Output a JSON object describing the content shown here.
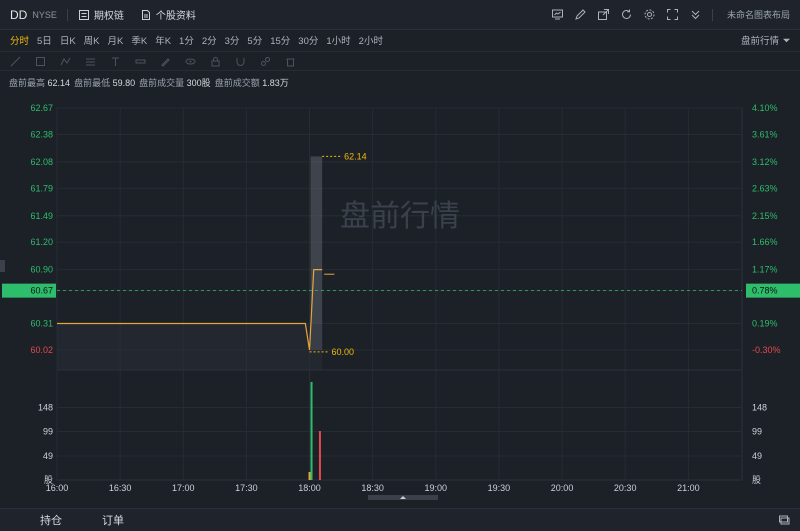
{
  "header": {
    "symbol": "DD",
    "exchange": "NYSE",
    "options_chain_label": "期权链",
    "stock_profile_label": "个股资料",
    "layout_label": "未命名图表布局"
  },
  "periods": [
    "分时",
    "5日",
    "日K",
    "周K",
    "月K",
    "季K",
    "年K",
    "1分",
    "2分",
    "3分",
    "5分",
    "15分",
    "30分",
    "1小时",
    "2小时"
  ],
  "active_period": "分时",
  "session_selector": "盘前行情",
  "stats": [
    {
      "label": "盘前最高",
      "value": "62.14"
    },
    {
      "label": "盘前最低",
      "value": "59.80"
    },
    {
      "label": "盘前成交量",
      "value": "300股"
    },
    {
      "label": "盘前成交额",
      "value": "1.83万"
    }
  ],
  "watermark": "盘前行情",
  "chart_data": {
    "type": "line",
    "x_ticks": [
      "16:00",
      "16:30",
      "17:00",
      "17:30",
      "18:00",
      "18:30",
      "19:00",
      "19:30",
      "20:00",
      "20:30",
      "21:00"
    ],
    "price_ticks": [
      "62.67",
      "62.38",
      "62.08",
      "61.79",
      "61.49",
      "61.20",
      "60.90",
      "60.67",
      "60.31",
      "60.02"
    ],
    "pct_ticks": [
      "4.10%",
      "3.61%",
      "3.12%",
      "2.63%",
      "2.15%",
      "1.66%",
      "1.17%",
      "0.78%",
      "0.19%",
      "-0.30%"
    ],
    "ylim": [
      60.02,
      62.67
    ],
    "prev_close": 60.67,
    "current_price_label": "60.67",
    "current_pct_label": "0.78%",
    "price_series": [
      {
        "time": "16:00",
        "value": 60.31
      },
      {
        "time": "17:58",
        "value": 60.31
      },
      {
        "time": "18:00",
        "value": 60.02
      },
      {
        "time": "18:02",
        "value": 60.9
      },
      {
        "time": "18:06",
        "value": 60.9
      }
    ],
    "price_band_max": 62.14,
    "high_label": "62.14",
    "low_label": "60.00",
    "avg_tick": {
      "time": "18:08",
      "value": 60.85
    },
    "volume_ticks": [
      "148",
      "99",
      "49",
      "股"
    ],
    "volume_bars": [
      {
        "time": "18:00",
        "value": 200,
        "color": "#2ebd6a"
      },
      {
        "time": "18:04",
        "value": 100,
        "color": "#e5484d"
      }
    ],
    "colors": {
      "up": "#2ebd6a",
      "down": "#e5484d",
      "line": "#e8a53c",
      "accent": "#f0b90b"
    }
  },
  "bottom_tabs": [
    "持仓",
    "订单"
  ]
}
